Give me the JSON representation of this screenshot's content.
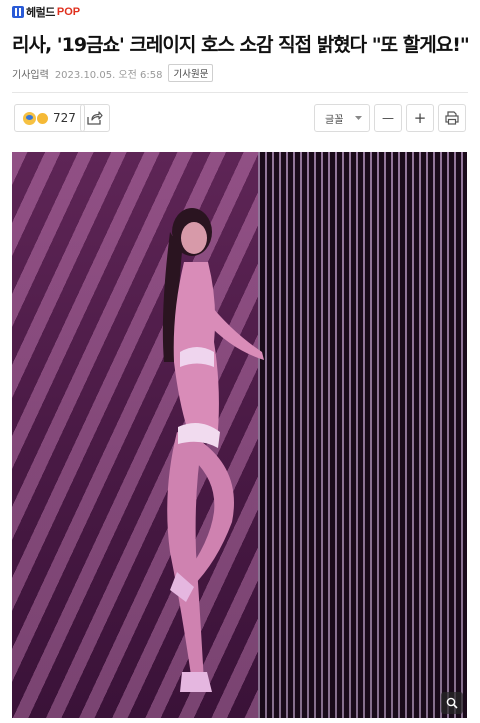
{
  "brand": {
    "name": "헤럴드",
    "suffix": "POP",
    "accent": "#e0301e",
    "mark_color": "#2a5bd7"
  },
  "article": {
    "headline": "리사, '19금쇼' 크레이지 호스 소감 직접 밝혔다 \"또 할게요!\"",
    "meta_label": "기사입력",
    "published": "2023.10.05. 오전 6:58",
    "origin_link": "기사원문"
  },
  "toolbar": {
    "reaction_count": "727",
    "font_label": "글꼴",
    "decrease": "—",
    "increase": "+"
  },
  "icons": [
    "reaction-emoji-icon",
    "share-icon",
    "chevron-down-icon",
    "minus-icon",
    "plus-icon",
    "print-icon",
    "zoom-icon"
  ]
}
